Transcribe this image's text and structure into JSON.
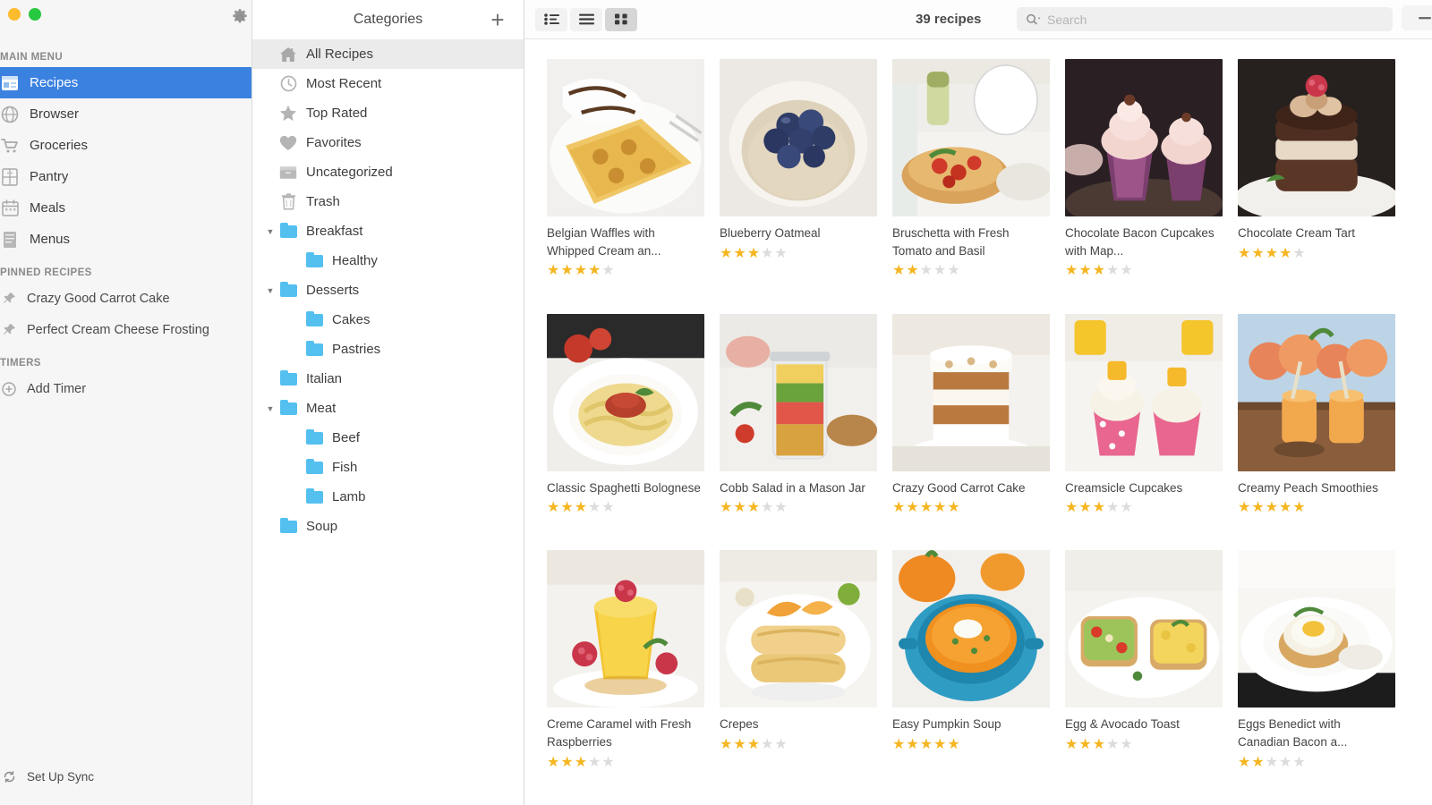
{
  "window": {
    "traffic_lights": [
      "close",
      "minimize",
      "zoom"
    ],
    "gear_label": "gear-icon"
  },
  "sidebar": {
    "sections": [
      {
        "label": "MAIN MENU"
      },
      {
        "label": "PINNED RECIPES"
      },
      {
        "label": "TIMERS"
      }
    ],
    "main_menu": [
      {
        "label": "Recipes",
        "icon": "recipes-icon",
        "selected": true
      },
      {
        "label": "Browser",
        "icon": "browser-icon",
        "selected": false
      },
      {
        "label": "Groceries",
        "icon": "groceries-icon",
        "selected": false
      },
      {
        "label": "Pantry",
        "icon": "pantry-icon",
        "selected": false
      },
      {
        "label": "Meals",
        "icon": "meals-icon",
        "selected": false
      },
      {
        "label": "Menus",
        "icon": "menus-icon",
        "selected": false
      }
    ],
    "pinned_recipes": [
      {
        "label": "Crazy Good Carrot Cake",
        "icon": "pin-icon"
      },
      {
        "label": "Perfect Cream Cheese Frosting",
        "icon": "pin-icon"
      }
    ],
    "timers": [
      {
        "label": "Add Timer",
        "icon": "plus-circle-icon"
      }
    ],
    "sync": {
      "label": "Set Up Sync",
      "icon": "sync-icon"
    }
  },
  "categories": {
    "title": "Categories",
    "add_label": "+",
    "items": [
      {
        "label": "All Recipes",
        "icon": "home-icon",
        "indent": 0,
        "selected": true,
        "disclosure": ""
      },
      {
        "label": "Most Recent",
        "icon": "clock-icon",
        "indent": 0,
        "selected": false,
        "disclosure": ""
      },
      {
        "label": "Top Rated",
        "icon": "star-icon",
        "indent": 0,
        "selected": false,
        "disclosure": ""
      },
      {
        "label": "Favorites",
        "icon": "heart-icon",
        "indent": 0,
        "selected": false,
        "disclosure": ""
      },
      {
        "label": "Uncategorized",
        "icon": "box-icon",
        "indent": 0,
        "selected": false,
        "disclosure": ""
      },
      {
        "label": "Trash",
        "icon": "trash-icon",
        "indent": 0,
        "selected": false,
        "disclosure": ""
      },
      {
        "label": "Breakfast",
        "icon": "folder-icon",
        "indent": 0,
        "selected": false,
        "disclosure": "▼"
      },
      {
        "label": "Healthy",
        "icon": "folder-icon",
        "indent": 1,
        "selected": false,
        "disclosure": ""
      },
      {
        "label": "Desserts",
        "icon": "folder-icon",
        "indent": 0,
        "selected": false,
        "disclosure": "▼"
      },
      {
        "label": "Cakes",
        "icon": "folder-icon",
        "indent": 1,
        "selected": false,
        "disclosure": ""
      },
      {
        "label": "Pastries",
        "icon": "folder-icon",
        "indent": 1,
        "selected": false,
        "disclosure": ""
      },
      {
        "label": "Italian",
        "icon": "folder-icon",
        "indent": 0,
        "selected": false,
        "disclosure": ""
      },
      {
        "label": "Meat",
        "icon": "folder-icon",
        "indent": 0,
        "selected": false,
        "disclosure": "▼"
      },
      {
        "label": "Beef",
        "icon": "folder-icon",
        "indent": 1,
        "selected": false,
        "disclosure": ""
      },
      {
        "label": "Fish",
        "icon": "folder-icon",
        "indent": 1,
        "selected": false,
        "disclosure": ""
      },
      {
        "label": "Lamb",
        "icon": "folder-icon",
        "indent": 1,
        "selected": false,
        "disclosure": ""
      },
      {
        "label": "Soup",
        "icon": "folder-icon",
        "indent": 0,
        "selected": false,
        "disclosure": ""
      }
    ]
  },
  "toolbar": {
    "view_modes": [
      {
        "name": "list-detail-view",
        "active": false
      },
      {
        "name": "list-rows-view",
        "active": false
      },
      {
        "name": "grid-view",
        "active": true
      }
    ],
    "recipe_count": "39 recipes",
    "search_placeholder": "Search",
    "search_value": ""
  },
  "recipes": [
    {
      "title": "Belgian Waffles with Whipped Cream an...",
      "rating": 4,
      "image": "waffles"
    },
    {
      "title": "Blueberry Oatmeal",
      "rating": 3,
      "image": "oatmeal"
    },
    {
      "title": "Bruschetta with Fresh Tomato and Basil",
      "rating": 2,
      "image": "bruschetta"
    },
    {
      "title": "Chocolate Bacon Cupcakes with Map...",
      "rating": 3,
      "image": "choc-cupcakes"
    },
    {
      "title": "Chocolate Cream Tart",
      "rating": 4,
      "image": "choc-tart"
    },
    {
      "title": "Classic Spaghetti Bolognese",
      "rating": 3,
      "image": "spaghetti"
    },
    {
      "title": "Cobb Salad in a Mason Jar",
      "rating": 3,
      "image": "cobb-salad"
    },
    {
      "title": "Crazy Good Carrot Cake",
      "rating": 5,
      "image": "carrot-cake"
    },
    {
      "title": "Creamsicle Cupcakes",
      "rating": 3,
      "image": "creamsicle"
    },
    {
      "title": "Creamy Peach Smoothies",
      "rating": 5,
      "image": "peach-smoothie"
    },
    {
      "title": "Creme Caramel with Fresh Raspberries",
      "rating": 3,
      "image": "creme-caramel"
    },
    {
      "title": "Crepes",
      "rating": 3,
      "image": "crepes"
    },
    {
      "title": "Easy Pumpkin Soup",
      "rating": 5,
      "image": "pumpkin-soup"
    },
    {
      "title": "Egg & Avocado Toast",
      "rating": 3,
      "image": "avocado-toast"
    },
    {
      "title": "Eggs Benedict with Canadian Bacon a...",
      "rating": 2,
      "image": "eggs-benedict"
    }
  ],
  "colors": {
    "accent_blue": "#3b82e0",
    "folder_blue": "#54c0f0",
    "star_gold": "#f5b622",
    "star_empty": "#dcdcdc",
    "sidebar_bg": "#f6f6f6"
  }
}
